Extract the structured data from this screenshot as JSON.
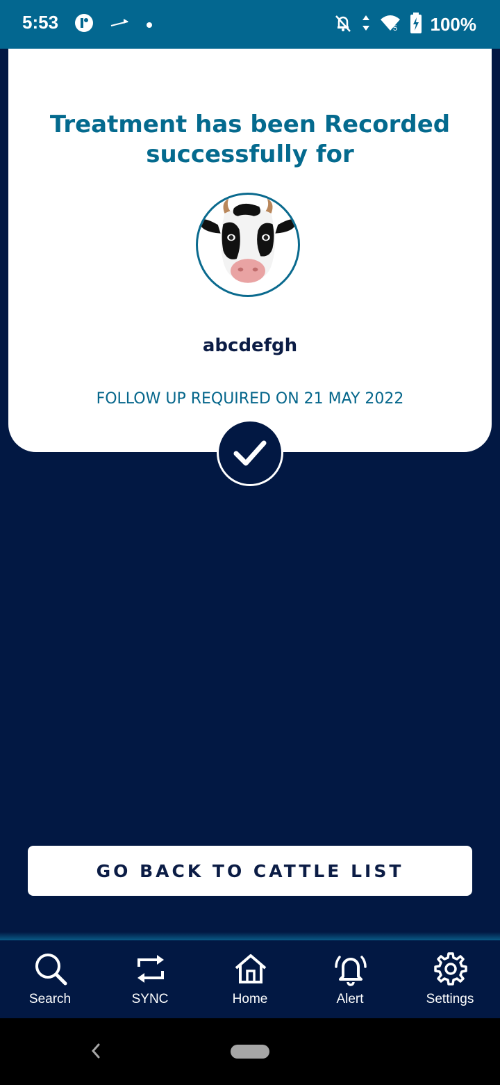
{
  "status_bar": {
    "time": "5:53",
    "battery": "100%",
    "icons": [
      "app-notification-icon",
      "airplane-arrow-icon",
      "dot-icon",
      "notifications-off-icon",
      "data-arrows-icon",
      "wifi-icon",
      "battery-charging-icon"
    ]
  },
  "card": {
    "headline_line1": "Treatment has been Recorded",
    "headline_line2": "successfully for",
    "cattle_name": "abcdefgh",
    "followup": "FOLLOW UP REQUIRED ON 21 MAY 2022",
    "avatar_icon": "cow-face-icon",
    "confirm_icon": "checkmark-icon"
  },
  "actions": {
    "back_label": "GO BACK TO CATTLE LIST"
  },
  "bottom_nav": {
    "items": [
      {
        "label": "Search",
        "icon": "search-icon"
      },
      {
        "label": "SYNC",
        "icon": "sync-icon"
      },
      {
        "label": "Home",
        "icon": "home-icon"
      },
      {
        "label": "Alert",
        "icon": "bell-icon"
      },
      {
        "label": "Settings",
        "icon": "gear-icon"
      }
    ]
  },
  "colors": {
    "background": "#021843",
    "status_bar": "#036790",
    "headline": "#046a8e",
    "card": "#ffffff"
  }
}
